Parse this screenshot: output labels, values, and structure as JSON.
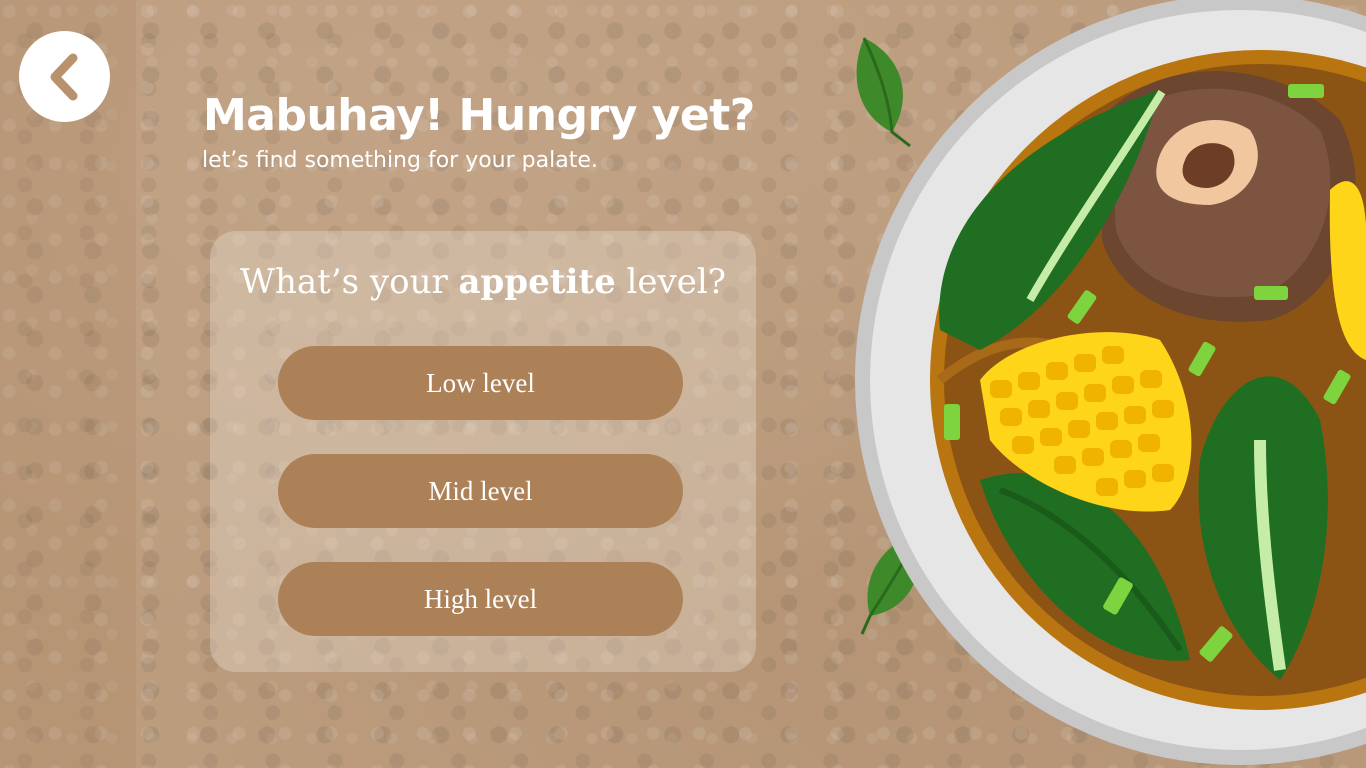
{
  "header": {
    "title": "Mabuhay! Hungry yet?",
    "subtitle": "let’s find something for your palate."
  },
  "nav": {
    "back_icon": "chevron-left-icon"
  },
  "quiz": {
    "question_start": "What’s your ",
    "question_emphasis": "appetite",
    "question_end": " level?",
    "options": [
      {
        "label": "Low level"
      },
      {
        "label": "Mid level"
      },
      {
        "label": "High level"
      }
    ]
  },
  "colors": {
    "background": "#bb9c7d",
    "button": "#ad8158",
    "card": "#ebe1d7",
    "text": "#ffffff"
  },
  "decor": {
    "dish_icon": "soup-bowl-illustration",
    "leaf_icon": "leaf-icon"
  }
}
